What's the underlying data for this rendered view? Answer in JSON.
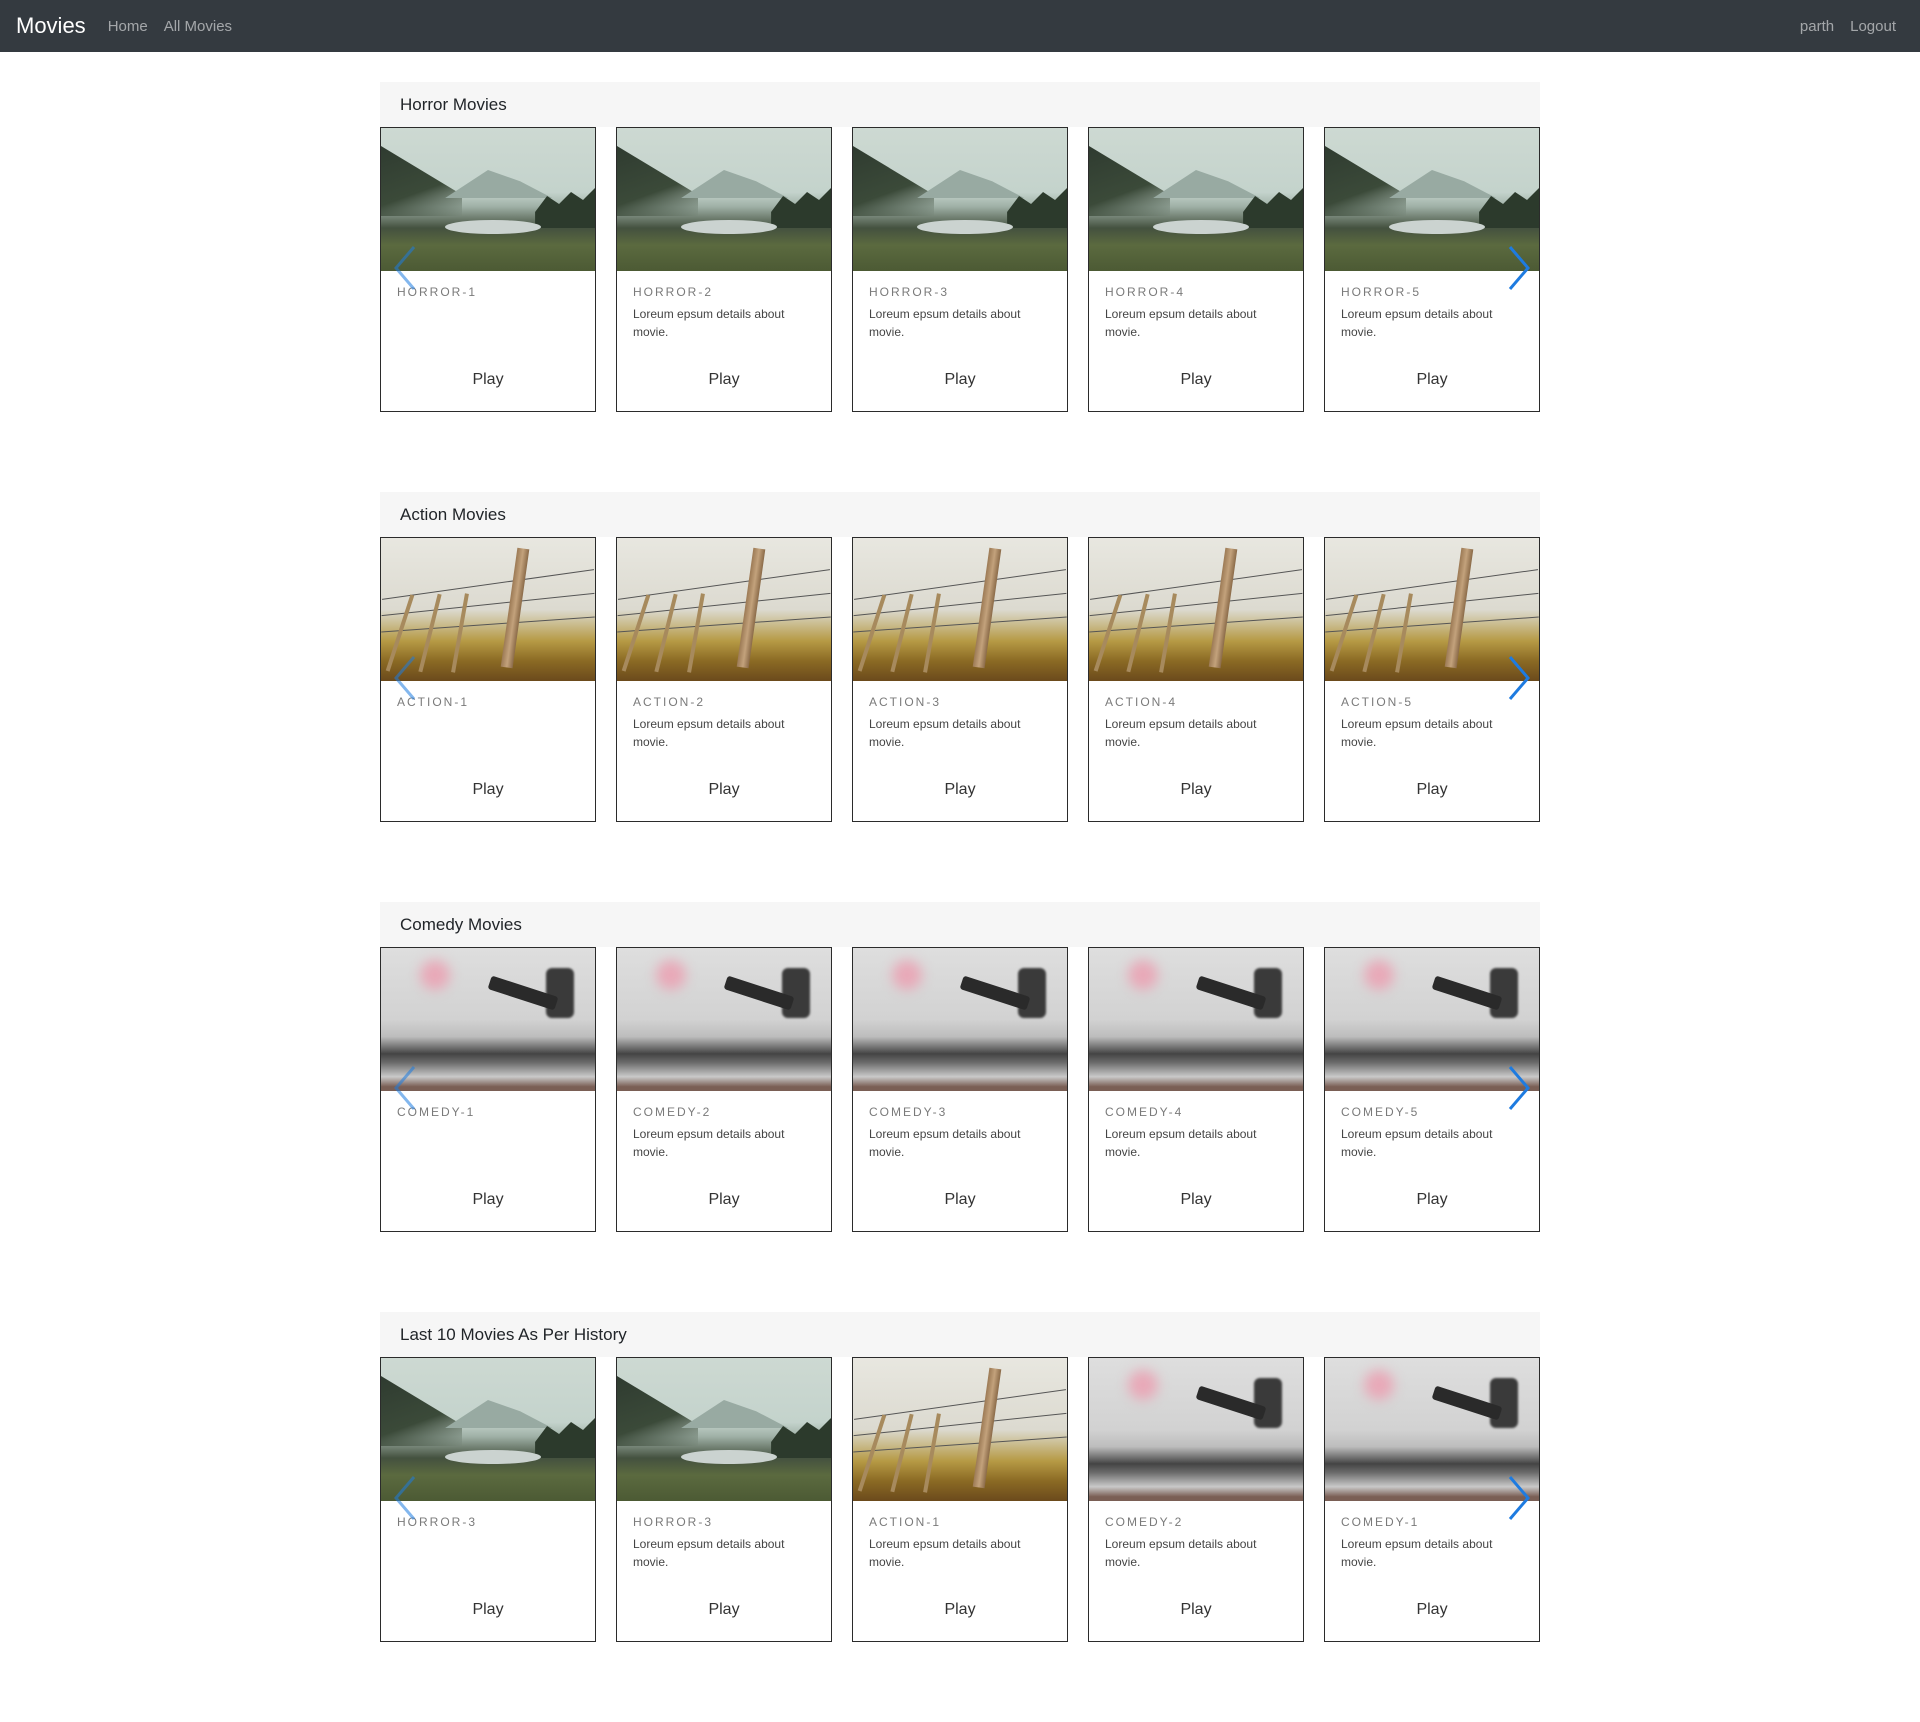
{
  "navbar": {
    "brand": "Movies",
    "links": [
      "Home",
      "All Movies"
    ],
    "user": "parth",
    "logout": "Logout"
  },
  "sections": [
    {
      "title": "Horror Movies",
      "cards": [
        {
          "title": "HORROR-1",
          "text": "",
          "image": "lake",
          "play": "Play"
        },
        {
          "title": "HORROR-2",
          "text": "Loreum epsum details about movie.",
          "image": "lake",
          "play": "Play"
        },
        {
          "title": "HORROR-3",
          "text": "Loreum epsum details about movie.",
          "image": "lake",
          "play": "Play"
        },
        {
          "title": "HORROR-4",
          "text": "Loreum epsum details about movie.",
          "image": "lake",
          "play": "Play"
        },
        {
          "title": "HORROR-5",
          "text": "Loreum epsum details about movie.",
          "image": "lake",
          "play": "Play"
        }
      ]
    },
    {
      "title": "Action Movies",
      "cards": [
        {
          "title": "ACTION-1",
          "text": "",
          "image": "fence",
          "play": "Play"
        },
        {
          "title": "ACTION-2",
          "text": "Loreum epsum details about movie.",
          "image": "fence",
          "play": "Play"
        },
        {
          "title": "ACTION-3",
          "text": "Loreum epsum details about movie.",
          "image": "fence",
          "play": "Play"
        },
        {
          "title": "ACTION-4",
          "text": "Loreum epsum details about movie.",
          "image": "fence",
          "play": "Play"
        },
        {
          "title": "ACTION-5",
          "text": "Loreum epsum details about movie.",
          "image": "fence",
          "play": "Play"
        }
      ]
    },
    {
      "title": "Comedy Movies",
      "cards": [
        {
          "title": "COMEDY-1",
          "text": "",
          "image": "record",
          "play": "Play"
        },
        {
          "title": "COMEDY-2",
          "text": "Loreum epsum details about movie.",
          "image": "record",
          "play": "Play"
        },
        {
          "title": "COMEDY-3",
          "text": "Loreum epsum details about movie.",
          "image": "record",
          "play": "Play"
        },
        {
          "title": "COMEDY-4",
          "text": "Loreum epsum details about movie.",
          "image": "record",
          "play": "Play"
        },
        {
          "title": "COMEDY-5",
          "text": "Loreum epsum details about movie.",
          "image": "record",
          "play": "Play"
        }
      ]
    },
    {
      "title": "Last 10 Movies As Per History",
      "cards": [
        {
          "title": "HORROR-3",
          "text": "",
          "image": "lake",
          "play": "Play"
        },
        {
          "title": "HORROR-3",
          "text": "Loreum epsum details about movie.",
          "image": "lake",
          "play": "Play"
        },
        {
          "title": "ACTION-1",
          "text": "Loreum epsum details about movie.",
          "image": "fence",
          "play": "Play"
        },
        {
          "title": "COMEDY-2",
          "text": "Loreum epsum details about movie.",
          "image": "record",
          "play": "Play"
        },
        {
          "title": "COMEDY-1",
          "text": "Loreum epsum details about movie.",
          "image": "record",
          "play": "Play"
        }
      ]
    }
  ],
  "colors": {
    "navbar_bg": "#343a40",
    "arrow": "#1e7be0",
    "section_header_bg": "#f6f6f6"
  },
  "icons": {
    "prev": "chevron-left-icon",
    "next": "chevron-right-icon"
  }
}
